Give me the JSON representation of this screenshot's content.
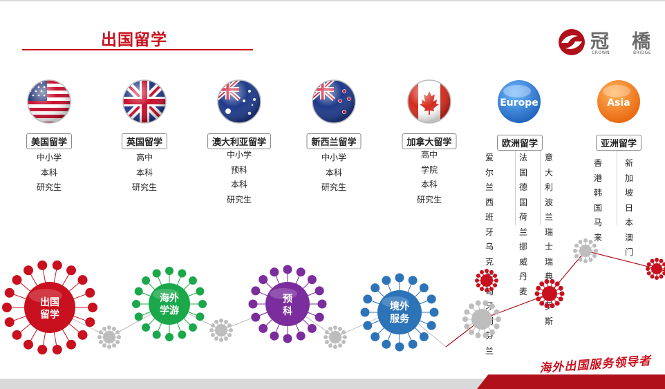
{
  "header": {
    "title": "出国留学"
  },
  "logo": {
    "name_cn_1": "冠",
    "name_cn_2": "橋",
    "name_en_1": "CROWN",
    "name_en_2": "BRIDGE"
  },
  "countries": [
    {
      "badge": "美国留学",
      "items": [
        "中小学",
        "本科",
        "研究生"
      ]
    },
    {
      "badge": "英国留学",
      "items": [
        "高中",
        "本科",
        "研究生"
      ]
    },
    {
      "badge": "澳大利亚留学",
      "items": [
        "中小学",
        "预科",
        "本科",
        "研究生"
      ]
    },
    {
      "badge": "新西兰留学",
      "items": [
        "中小学",
        "本科",
        "研究生"
      ]
    },
    {
      "badge": "加拿大留学",
      "items": [
        "高中",
        "学院",
        "本科",
        "研究生"
      ]
    }
  ],
  "europe": {
    "ball_label": "Europe",
    "badge": "欧洲留学",
    "columns": [
      [
        "爱尔兰",
        "西班牙",
        "乌克兰",
        "匈牙利",
        "芬兰"
      ],
      [
        "法国",
        "德国",
        "荷兰",
        "挪威",
        "丹麦"
      ],
      [
        "意大利",
        "波兰",
        "瑞士",
        "瑞典",
        "俄罗斯"
      ]
    ]
  },
  "asia": {
    "ball_label": "Asia",
    "badge": "亚洲留学",
    "columns": [
      [
        "香港",
        "韩国",
        "马来"
      ],
      [
        "新加坡",
        "日本",
        "澳门"
      ]
    ]
  },
  "services": [
    {
      "line1": "出国",
      "line2": "留学",
      "color": "#c8101e"
    },
    {
      "line1": "海外",
      "line2": "学游",
      "color": "#1aa84a"
    },
    {
      "line1": "预",
      "line2": "科",
      "color": "#7b2d9e"
    },
    {
      "line1": "境外",
      "line2": "服务",
      "color": "#2d73b8"
    }
  ],
  "slogan": "海外出国服务领导者",
  "colors": {
    "accent": "#c8101e",
    "gray_node": "#bdbdbd"
  }
}
